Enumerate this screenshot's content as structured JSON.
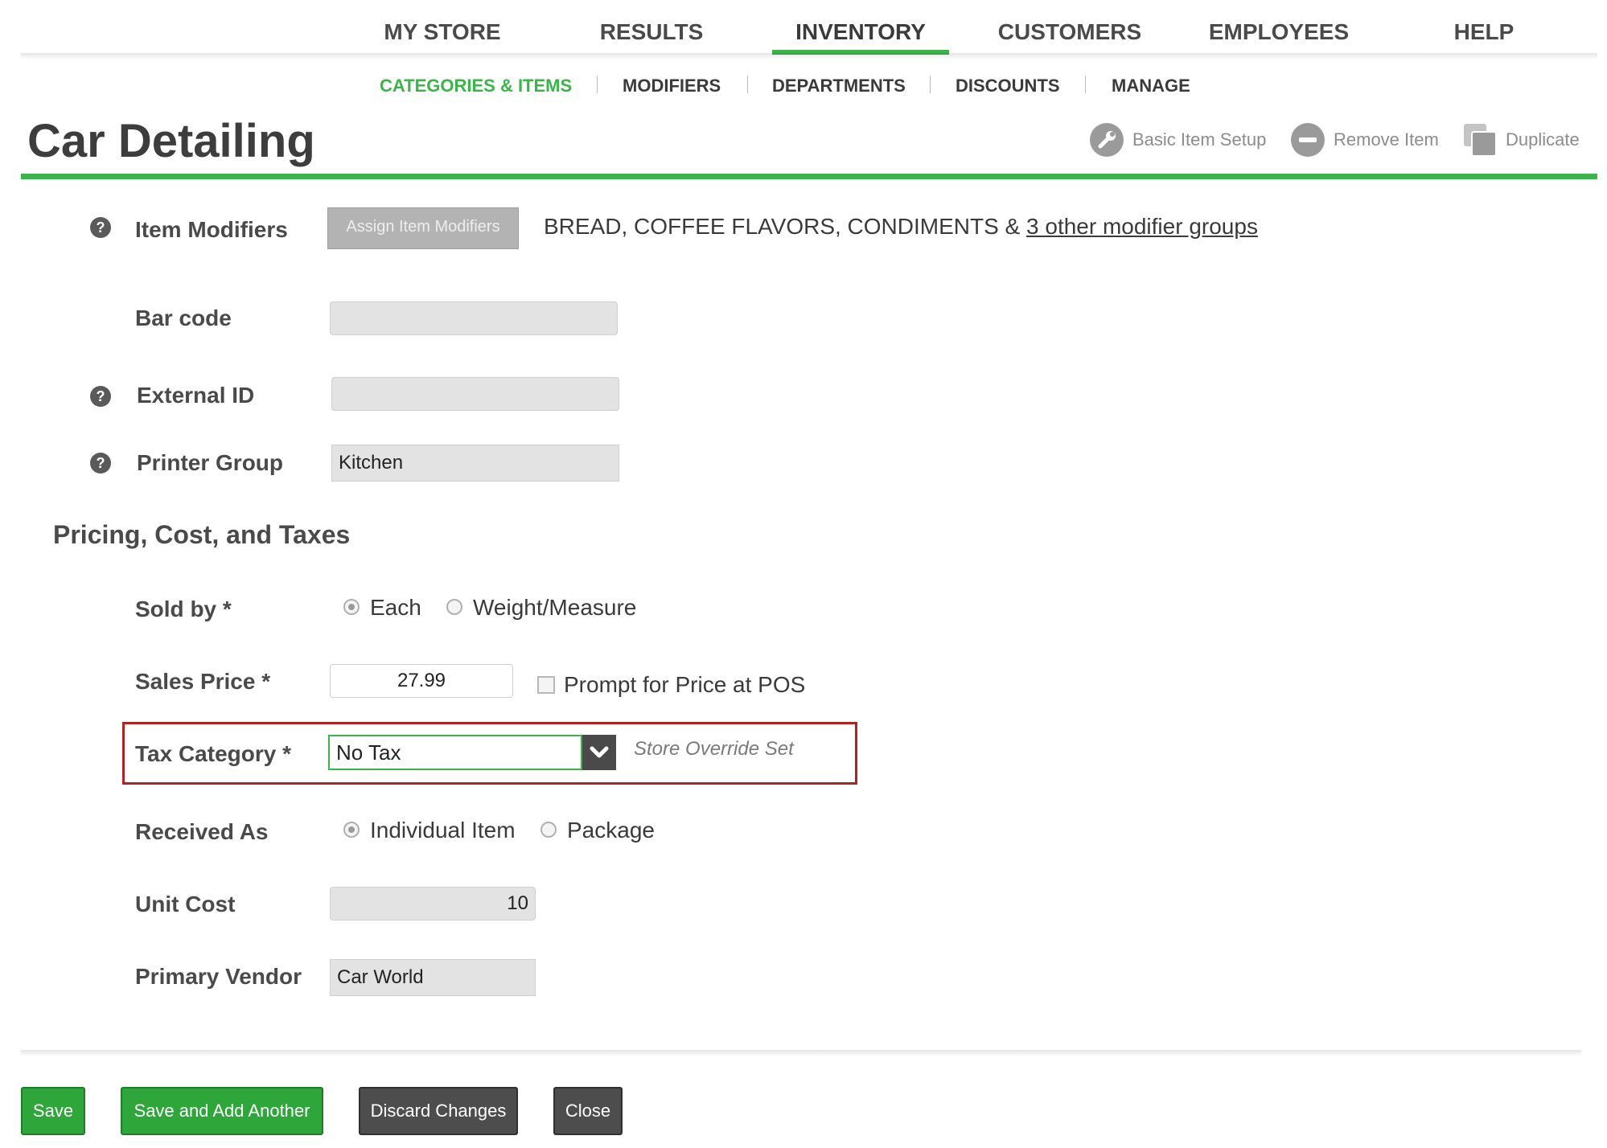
{
  "nav": {
    "items": [
      {
        "label": "MY STORE",
        "active": false
      },
      {
        "label": "RESULTS",
        "active": false
      },
      {
        "label": "INVENTORY",
        "active": true
      },
      {
        "label": "CUSTOMERS",
        "active": false
      },
      {
        "label": "EMPLOYEES",
        "active": false
      },
      {
        "label": "HELP",
        "active": false
      }
    ],
    "accent_color": "#3bb54a"
  },
  "subnav": {
    "items": [
      {
        "label": "CATEGORIES & ITEMS",
        "active": true
      },
      {
        "label": "MODIFIERS",
        "active": false
      },
      {
        "label": "DEPARTMENTS",
        "active": false
      },
      {
        "label": "DISCOUNTS",
        "active": false
      },
      {
        "label": "MANAGE",
        "active": false
      }
    ]
  },
  "page": {
    "title": "Car Detailing",
    "actions": [
      {
        "label": "Basic Item Setup",
        "icon": "wrench-icon"
      },
      {
        "label": "Remove Item",
        "icon": "minus-circle-icon"
      },
      {
        "label": "Duplicate",
        "icon": "duplicate-icon"
      }
    ]
  },
  "form": {
    "item_modifiers": {
      "label": "Item Modifiers",
      "button": "Assign Item Modifiers",
      "summary_text": "BREAD, COFFEE FLAVORS, CONDIMENTS & ",
      "summary_link": "3 other modifier groups"
    },
    "bar_code": {
      "label": "Bar code",
      "value": ""
    },
    "external_id": {
      "label": "External ID",
      "value": ""
    },
    "printer_group": {
      "label": "Printer Group",
      "value": "Kitchen"
    },
    "pricing_heading": "Pricing, Cost, and Taxes",
    "sold_by": {
      "label": "Sold by *",
      "options": [
        "Each",
        "Weight/Measure"
      ],
      "selected": "Each"
    },
    "sales_price": {
      "label": "Sales Price *",
      "value": "27.99",
      "prompt_label": "Prompt for Price at POS",
      "prompt_checked": false
    },
    "tax_category": {
      "label": "Tax Category *",
      "value": "No Tax",
      "note": "Store Override Set"
    },
    "received_as": {
      "label": "Received As",
      "options": [
        "Individual Item",
        "Package"
      ],
      "selected": "Individual Item"
    },
    "unit_cost": {
      "label": "Unit Cost",
      "value": "10"
    },
    "primary_vendor": {
      "label": "Primary Vendor",
      "value": "Car World"
    },
    "help_glyph": "?"
  },
  "buttons": {
    "save": "Save",
    "save_add": "Save and Add Another",
    "discard": "Discard Changes",
    "close": "Close"
  },
  "colors": {
    "green": "#3bb54a",
    "highlight_red": "#b22222",
    "dark_button": "#4d4d4d"
  }
}
